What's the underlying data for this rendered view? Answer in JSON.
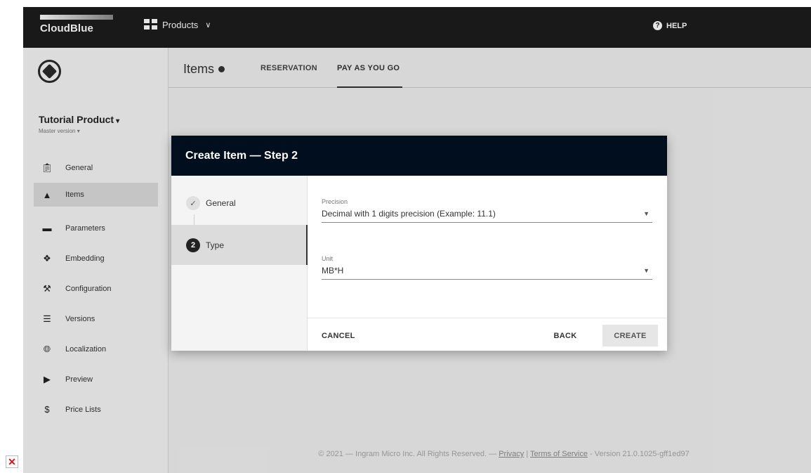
{
  "topbar": {
    "brand": "CloudBlue",
    "products_label": "Products",
    "help_label": "HELP"
  },
  "sidebar": {
    "product_name": "Tutorial Product",
    "version": "Master version",
    "items": [
      {
        "label": "General",
        "icon": "clipboard-icon"
      },
      {
        "label": "Items",
        "icon": "shapes-icon"
      },
      {
        "label": "Parameters",
        "icon": "toggle-icon"
      },
      {
        "label": "Embedding",
        "icon": "puzzle-icon"
      },
      {
        "label": "Configuration",
        "icon": "wrench-icon"
      },
      {
        "label": "Versions",
        "icon": "list-icon"
      },
      {
        "label": "Localization",
        "icon": "globe-icon"
      },
      {
        "label": "Preview",
        "icon": "play-icon"
      },
      {
        "label": "Price Lists",
        "icon": "dollar-icon"
      }
    ]
  },
  "main": {
    "title": "Items",
    "tabs": [
      {
        "label": "RESERVATION"
      },
      {
        "label": "PAY AS YOU GO"
      }
    ],
    "footer": {
      "prefix": "© 2021 — Ingram Micro Inc. All Rights Reserved. — ",
      "privacy": "Privacy",
      "sep": " | ",
      "terms": "Terms of Service",
      "version": " - Version 21.0.1025-gff1ed97"
    }
  },
  "dialog": {
    "title": "Create Item — Step 2",
    "steps": [
      {
        "label": "General",
        "number": "✓"
      },
      {
        "label": "Type",
        "number": "2"
      }
    ],
    "fields": {
      "precision": {
        "label": "Precision",
        "value": "Decimal with 1 digits precision (Example: 11.1)"
      },
      "unit": {
        "label": "Unit",
        "value": "MB*H"
      }
    },
    "buttons": {
      "cancel": "CANCEL",
      "back": "BACK",
      "create": "CREATE"
    }
  },
  "colors": {
    "topbar": "#1c1c1c",
    "dialog_header": "#000e1e"
  }
}
